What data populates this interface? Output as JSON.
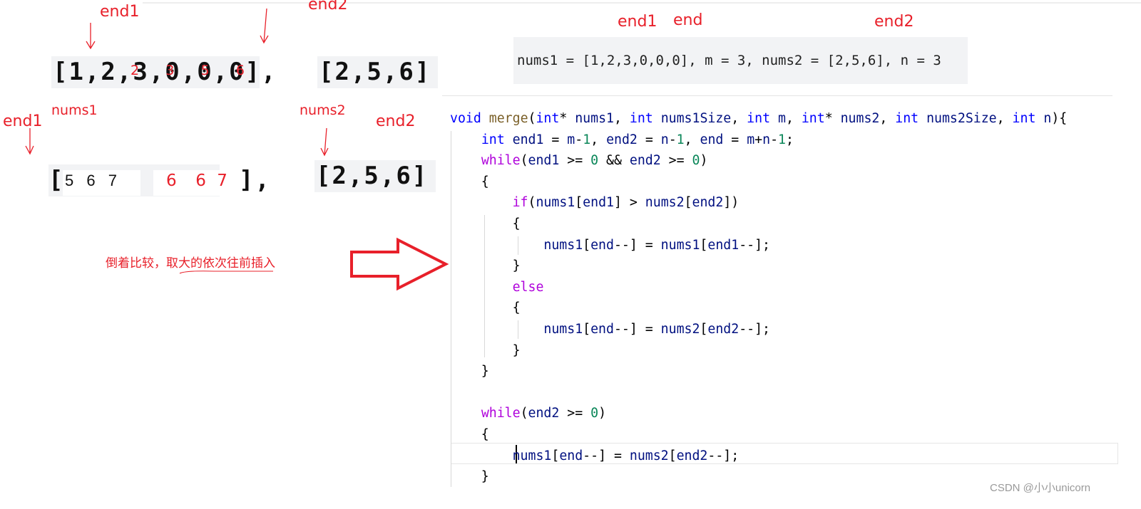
{
  "labels": {
    "end1_a": "end1",
    "end2_a": "end2",
    "nums1": "nums1",
    "nums2": "nums2",
    "end1_b": "end1",
    "end2_b": "end2",
    "end1_c": "end1",
    "end_c": "end",
    "end2_c": "end2"
  },
  "arrays": {
    "nums1_initial": "[1,2,3,0,0,0],",
    "nums2_initial": "[2,5,6]",
    "nums1_open": "[",
    "nums1_black": "5 6 7",
    "nums1_red": "6  6 7",
    "nums1_close": "],",
    "nums2_second": "[2,5,6]"
  },
  "overlay_digits": [
    "2",
    "3",
    "5",
    "6"
  ],
  "note": "倒着比较，取大的依次往前插入",
  "example": "nums1 = [1,2,3,0,0,0], m = 3, nums2 = [2,5,6], n = 3",
  "watermark": "CSDN @小小unicorn",
  "colors": {
    "annotation": "#e8202a",
    "keyword": "#0000ff",
    "control": "#af00db",
    "function": "#795e26",
    "number": "#098658",
    "identifier": "#001080"
  },
  "code": [
    [
      [
        "kw",
        "void"
      ],
      [
        "p",
        " "
      ],
      [
        "fn",
        "merge"
      ],
      [
        "p",
        "("
      ],
      [
        "kw",
        "int"
      ],
      [
        "p",
        "* "
      ],
      [
        "id",
        "nums1"
      ],
      [
        "p",
        ", "
      ],
      [
        "kw",
        "int"
      ],
      [
        "p",
        " "
      ],
      [
        "id",
        "nums1Size"
      ],
      [
        "p",
        ", "
      ],
      [
        "kw",
        "int"
      ],
      [
        "p",
        " "
      ],
      [
        "id",
        "m"
      ],
      [
        "p",
        ", "
      ],
      [
        "kw",
        "int"
      ],
      [
        "p",
        "* "
      ],
      [
        "id",
        "nums2"
      ],
      [
        "p",
        ", "
      ],
      [
        "kw",
        "int"
      ],
      [
        "p",
        " "
      ],
      [
        "id",
        "nums2Size"
      ],
      [
        "p",
        ", "
      ],
      [
        "kw",
        "int"
      ],
      [
        "p",
        " "
      ],
      [
        "id",
        "n"
      ],
      [
        "p",
        "){"
      ]
    ],
    [
      [
        "p",
        "    "
      ],
      [
        "kw",
        "int"
      ],
      [
        "p",
        " "
      ],
      [
        "id",
        "end1"
      ],
      [
        "p",
        " = "
      ],
      [
        "id",
        "m"
      ],
      [
        "p",
        "-"
      ],
      [
        "num",
        "1"
      ],
      [
        "p",
        ", "
      ],
      [
        "id",
        "end2"
      ],
      [
        "p",
        " = "
      ],
      [
        "id",
        "n"
      ],
      [
        "p",
        "-"
      ],
      [
        "num",
        "1"
      ],
      [
        "p",
        ", "
      ],
      [
        "id",
        "end"
      ],
      [
        "p",
        " = "
      ],
      [
        "id",
        "m"
      ],
      [
        "p",
        "+"
      ],
      [
        "id",
        "n"
      ],
      [
        "p",
        "-"
      ],
      [
        "num",
        "1"
      ],
      [
        "p",
        ";"
      ]
    ],
    [
      [
        "p",
        "    "
      ],
      [
        "ctl",
        "while"
      ],
      [
        "p",
        "("
      ],
      [
        "id",
        "end1"
      ],
      [
        "p",
        " >= "
      ],
      [
        "num",
        "0"
      ],
      [
        "p",
        " && "
      ],
      [
        "id",
        "end2"
      ],
      [
        "p",
        " >= "
      ],
      [
        "num",
        "0"
      ],
      [
        "p",
        ")"
      ]
    ],
    [
      [
        "p",
        "    {"
      ]
    ],
    [
      [
        "p",
        "        "
      ],
      [
        "ctl",
        "if"
      ],
      [
        "p",
        "("
      ],
      [
        "id",
        "nums1"
      ],
      [
        "p",
        "["
      ],
      [
        "id",
        "end1"
      ],
      [
        "p",
        "] > "
      ],
      [
        "id",
        "nums2"
      ],
      [
        "p",
        "["
      ],
      [
        "id",
        "end2"
      ],
      [
        "p",
        "])"
      ]
    ],
    [
      [
        "p",
        "        {"
      ]
    ],
    [
      [
        "p",
        "            "
      ],
      [
        "id",
        "nums1"
      ],
      [
        "p",
        "["
      ],
      [
        "id",
        "end"
      ],
      [
        "p",
        "--] = "
      ],
      [
        "id",
        "nums1"
      ],
      [
        "p",
        "["
      ],
      [
        "id",
        "end1"
      ],
      [
        "p",
        "--];"
      ]
    ],
    [
      [
        "p",
        "        }"
      ]
    ],
    [
      [
        "p",
        "        "
      ],
      [
        "ctl",
        "else"
      ]
    ],
    [
      [
        "p",
        "        {"
      ]
    ],
    [
      [
        "p",
        "            "
      ],
      [
        "id",
        "nums1"
      ],
      [
        "p",
        "["
      ],
      [
        "id",
        "end"
      ],
      [
        "p",
        "--] = "
      ],
      [
        "id",
        "nums2"
      ],
      [
        "p",
        "["
      ],
      [
        "id",
        "end2"
      ],
      [
        "p",
        "--];"
      ]
    ],
    [
      [
        "p",
        "        }"
      ]
    ],
    [
      [
        "p",
        "    }"
      ]
    ],
    [
      [
        "p",
        ""
      ]
    ],
    [
      [
        "p",
        "    "
      ],
      [
        "ctl",
        "while"
      ],
      [
        "p",
        "("
      ],
      [
        "id",
        "end2"
      ],
      [
        "p",
        " >= "
      ],
      [
        "num",
        "0"
      ],
      [
        "p",
        ")"
      ]
    ],
    [
      [
        "p",
        "    {"
      ]
    ],
    [
      [
        "p",
        "        "
      ],
      [
        "id",
        "nums1"
      ],
      [
        "p",
        "["
      ],
      [
        "id",
        "end"
      ],
      [
        "p",
        "--] = "
      ],
      [
        "id",
        "nums2"
      ],
      [
        "p",
        "["
      ],
      [
        "id",
        "end2"
      ],
      [
        "p",
        "--];"
      ]
    ],
    [
      [
        "p",
        "    }"
      ]
    ]
  ]
}
